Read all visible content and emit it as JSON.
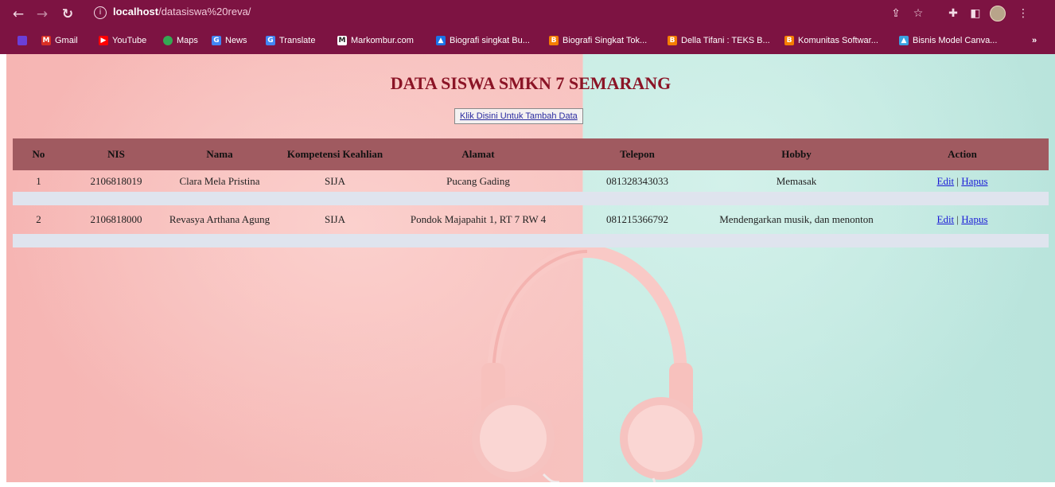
{
  "browser": {
    "url_host": "localhost",
    "url_path": "/datasiswa%20reva/",
    "bookmarks": [
      {
        "label": "Gmail",
        "icon": "gmail-icon",
        "color": "#d93025"
      },
      {
        "label": "YouTube",
        "icon": "youtube-icon",
        "color": "#ff0000"
      },
      {
        "label": "Maps",
        "icon": "maps-icon",
        "color": "#34a853"
      },
      {
        "label": "News",
        "icon": "news-icon",
        "color": "#4285f4"
      },
      {
        "label": "Translate",
        "icon": "translate-icon",
        "color": "#4285f4"
      },
      {
        "label": "Markombur.com",
        "icon": "markombur-icon",
        "color": "#222222"
      },
      {
        "label": "Biografi singkat Bu...",
        "icon": "biografi-icon",
        "color": "#1a73e8"
      },
      {
        "label": "Biografi Singkat Tok...",
        "icon": "blogger-icon",
        "color": "#f57d00"
      },
      {
        "label": "Della Tifani : TEKS B...",
        "icon": "blogger-icon",
        "color": "#f57d00"
      },
      {
        "label": "Komunitas Softwar...",
        "icon": "blogger-icon",
        "color": "#f57d00"
      },
      {
        "label": "Bisnis Model Canva...",
        "icon": "canva-icon",
        "color": "#3aa0e0"
      }
    ]
  },
  "page": {
    "title": "DATA SISWA SMKN 7 SEMARANG",
    "add_button": "Klik Disini Untuk Tambah Data"
  },
  "table": {
    "headers": [
      "No",
      "NIS",
      "Nama",
      "Kompetensi Keahlian",
      "Alamat",
      "Telepon",
      "Hobby",
      "Action"
    ],
    "rows": [
      {
        "no": "1",
        "nis": "2106818019",
        "nama": "Clara Mela Pristina",
        "kompetensi": "SIJA",
        "alamat": "Pucang Gading",
        "telepon": "081328343033",
        "hobby": "Memasak",
        "edit": "Edit",
        "sep": "|",
        "hapus": "Hapus"
      },
      {
        "no": "2",
        "nis": "2106818000",
        "nama": "Revasya Arthana Agung",
        "kompetensi": "SIJA",
        "alamat": "Pondok Majapahit 1, RT 7 RW 4",
        "telepon": "081215366792",
        "hobby": "Mendengarkan musik, dan menonton",
        "edit": "Edit",
        "sep": "|",
        "hapus": "Hapus"
      }
    ]
  },
  "colors": {
    "browser_frame": "#7d1342",
    "title": "#8b1426",
    "header_bg": "#a05a60",
    "spacer_row": "#dfe4ee",
    "link": "#1a1ad6"
  }
}
